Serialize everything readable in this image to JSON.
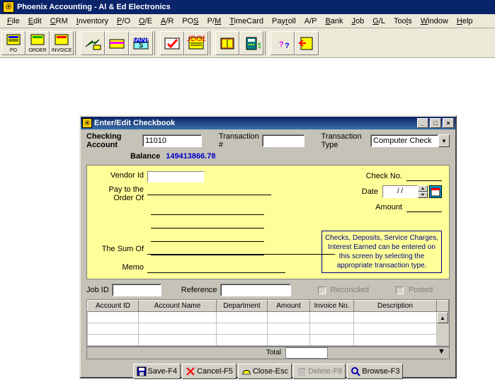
{
  "window": {
    "title": "Phoenix Accounting - Al & Ed Electronics"
  },
  "menu": [
    "File",
    "Edit",
    "CRM",
    "Inventory",
    "P/O",
    "O/E",
    "A/R",
    "POS",
    "P/M",
    "TimeCard",
    "Payroll",
    "A/P",
    "Bank",
    "Job",
    "G/L",
    "Tools",
    "Window",
    "Help"
  ],
  "toolbar": [
    {
      "name": "po",
      "label": "PO"
    },
    {
      "name": "order",
      "label": "ORDER"
    },
    {
      "name": "invoice",
      "label": "INVOICE"
    },
    {
      "name": "hand",
      "label": ""
    },
    {
      "name": "card",
      "label": ""
    },
    {
      "name": "bank",
      "label": ""
    },
    {
      "name": "check",
      "label": ""
    },
    {
      "name": "budget",
      "label": ""
    },
    {
      "name": "book",
      "label": ""
    },
    {
      "name": "calc",
      "label": ""
    },
    {
      "name": "help",
      "label": ""
    },
    {
      "name": "exit",
      "label": ""
    }
  ],
  "child": {
    "title": "Enter/Edit Checkbook",
    "checking_lbl": "Checking Account",
    "checking_val": "11010",
    "trans_num_lbl": "Transaction #",
    "trans_num_val": "",
    "trans_type_lbl": "Transaction Type",
    "trans_type_val": "Computer Check",
    "balance_lbl": "Balance",
    "balance_val": "149413866.78",
    "vendor_lbl": "Vendor Id",
    "payto_lbl": "Pay to the Order Of",
    "checkno_lbl": "Check No.",
    "date_lbl": "Date",
    "date_val": "/  /",
    "amount_lbl": "Amount",
    "sum_lbl": "The Sum Of",
    "memo_lbl": "Memo",
    "info": "Checks, Deposits, Service  Charges, Interest Earned  can be entered on this screen by selecting the appropriate  transaction type.",
    "jobid_lbl": "Job ID",
    "ref_lbl": "Reference",
    "reconciled_lbl": "Reconciled",
    "posted_lbl": "Posted",
    "grid_cols": [
      "Account ID",
      "Account Name",
      "Department",
      "Amount",
      "Invoice No.",
      "Description"
    ],
    "total_lbl": "Total",
    "buttons": {
      "save": "Save-F4",
      "cancel": "Cancel-F5",
      "close": "Close-Esc",
      "delete": "Delete-F8",
      "browse": "Browse-F3"
    }
  }
}
